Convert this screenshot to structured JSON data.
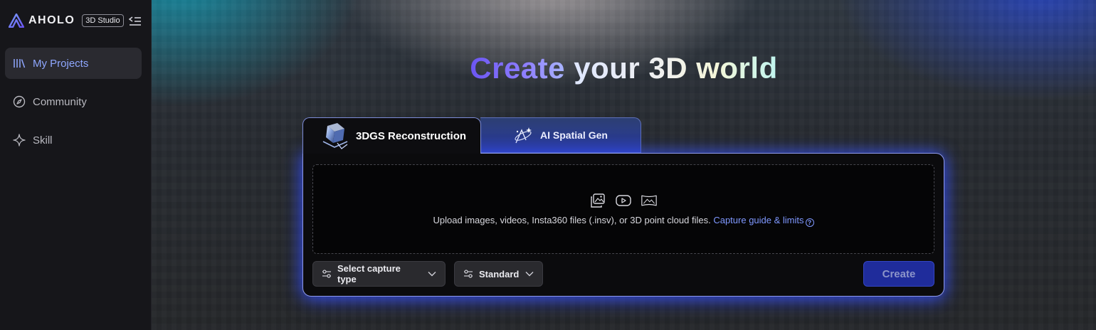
{
  "brand": {
    "name": "AHOLO",
    "badge": "3D Studio",
    "logo_icon": "aholo-logo-icon"
  },
  "sidebar": {
    "collapse_icon": "collapse-sidebar-icon",
    "items": [
      {
        "label": "My Projects",
        "icon": "library-icon",
        "active": true
      },
      {
        "label": "Community",
        "icon": "compass-icon",
        "active": false
      },
      {
        "label": "Skill",
        "icon": "sparkle-icon",
        "active": false
      }
    ]
  },
  "main": {
    "headline_part1": "Create",
    "headline_part2": "your 3D world",
    "tabs": [
      {
        "label": "3DGS Reconstruction",
        "active": true,
        "icon": "cube-reconstruction-icon"
      },
      {
        "label": "AI Spatial Gen",
        "active": false,
        "icon": "spatial-gen-icon"
      }
    ],
    "upload": {
      "icons": [
        "image-upload-icon",
        "video-icon",
        "panorama-icon"
      ],
      "text": "Upload images, videos, Insta360 files (.insv), or 3D point cloud files.",
      "link_text": "Capture guide & limits",
      "help_glyph": "?"
    },
    "controls": {
      "capture_type_label": "Select capture type",
      "quality_label": "Standard",
      "create_label": "Create"
    }
  },
  "colors": {
    "accent": "#8fa7ff",
    "create_button": "#1f2c9b",
    "panel_glow": "#3c5aff"
  }
}
